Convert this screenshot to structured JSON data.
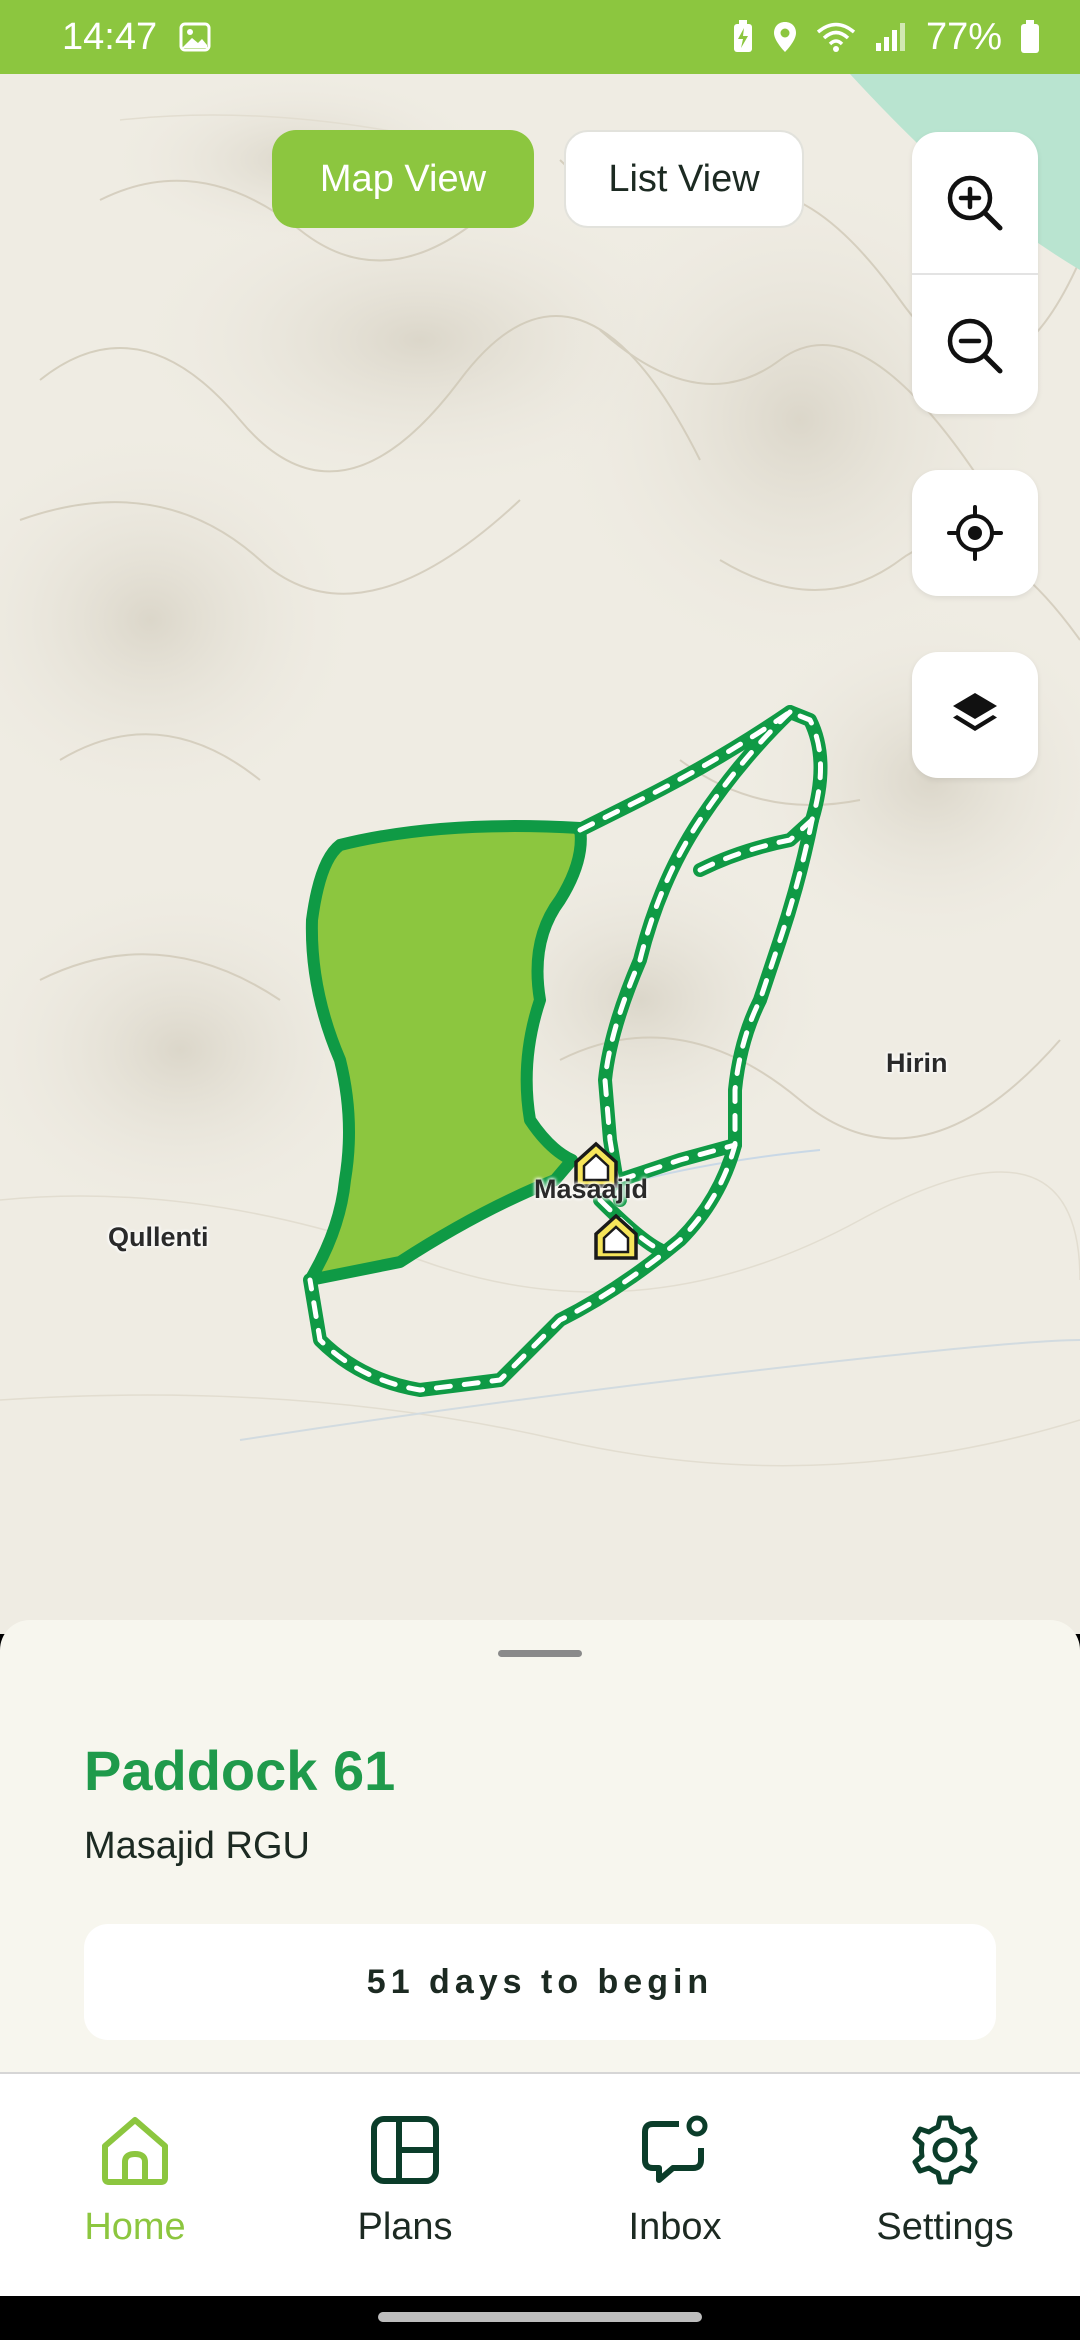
{
  "status_bar": {
    "time": "14:47",
    "battery": "77%",
    "icons": [
      "gallery-icon",
      "battery-saver-icon",
      "location-icon",
      "wifi-icon",
      "signal-icon",
      "battery-icon"
    ]
  },
  "map": {
    "view_toggle": {
      "map_label": "Map View",
      "list_label": "List View",
      "active": "map"
    },
    "controls": [
      "zoom-in-icon",
      "zoom-out-icon",
      "locate-icon",
      "layers-icon"
    ],
    "places": {
      "hirin": "Hirin",
      "qullenti": "Qullenti",
      "masaajid": "Masaajid"
    },
    "colors": {
      "paddock_fill": "#8cc63f",
      "boundary": "#0f9a45",
      "accent": "#8cc63f"
    }
  },
  "sheet": {
    "title": "Paddock 61",
    "subtitle": "Masajid RGU",
    "status": "51 days to begin"
  },
  "nav": {
    "items": [
      {
        "label": "Home",
        "icon": "home-icon",
        "active": true
      },
      {
        "label": "Plans",
        "icon": "plans-icon",
        "active": false
      },
      {
        "label": "Inbox",
        "icon": "inbox-icon",
        "active": false
      },
      {
        "label": "Settings",
        "icon": "gear-icon",
        "active": false
      }
    ]
  }
}
